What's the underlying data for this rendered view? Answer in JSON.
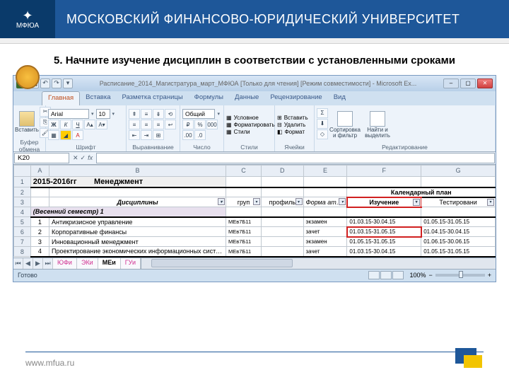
{
  "uni": {
    "logo": "МФЮА",
    "title": "МОСКОВСКИЙ ФИНАНСОВО-ЮРИДИЧЕСКИЙ УНИВЕРСИТЕТ"
  },
  "slide_title": "5. Начните изучение дисциплин в соответствии с установленными сроками",
  "window_title": "Расписание_2014_Магистратура_март_МФЮА [Только для чтения] [Режим совместимости] - Microsoft Ex...",
  "tabs": {
    "home": "Главная",
    "insert": "Вставка",
    "layout": "Разметка страницы",
    "formulas": "Формулы",
    "data": "Данные",
    "review": "Рецензирование",
    "view": "Вид"
  },
  "ribbon": {
    "clipboard": {
      "paste": "Вставить",
      "label": "Буфер обмена"
    },
    "font": {
      "name": "Arial",
      "size": "10",
      "label": "Шрифт",
      "bold": "Ж",
      "italic": "К",
      "underline": "Ч"
    },
    "align": {
      "label": "Выравнивание"
    },
    "number": {
      "format": "Общий",
      "label": "Число"
    },
    "styles": {
      "cond": "Условное",
      "fmt_tbl": "Форматировать",
      "cell_st": "Стили",
      "label": "Стили"
    },
    "cells": {
      "insert": "Вставить",
      "delete": "Удалить",
      "format": "Формат",
      "label": "Ячейки"
    },
    "editing": {
      "sum": "Σ",
      "sort": "Сортировка и фильтр",
      "find": "Найти и выделить",
      "label": "Редактирование"
    }
  },
  "name_box": "K20",
  "columns": {
    "sel": "",
    "A": "A",
    "B": "B",
    "C": "C",
    "D": "D",
    "E": "E",
    "F": "F",
    "G": "G"
  },
  "row1": {
    "years": "2015-2016гг",
    "title": "Менеджмент"
  },
  "hdr_right": "Календарный план",
  "headers": {
    "disc": "Дисциплины",
    "grp": "груп",
    "profile": "профиль",
    "form": "Форма аттестаци",
    "study": "Изучение",
    "test": "Тестировани"
  },
  "semester": "(Весенний семестр)   1",
  "rows": [
    {
      "n": "1",
      "name": "Антикризисное управление",
      "grp": "МЕв7Б11",
      "prof": "",
      "form": "экзамен",
      "study": "01.03.15-30.04.15",
      "test": "01.05.15-31.05.15"
    },
    {
      "n": "2",
      "name": "Корпоративные финансы",
      "grp": "МЕв7Б11",
      "prof": "",
      "form": "зачет",
      "study": "01.03.15-31.05.15",
      "test": "01.04.15-30.04.15"
    },
    {
      "n": "3",
      "name": "Инновационный менеджмент",
      "grp": "МЕв7Б11",
      "prof": "",
      "form": "экзамен",
      "study": "01.05.15-31.05.15",
      "test": "01.06.15-30.06.15"
    },
    {
      "n": "4",
      "name": "Проектирование экономических информационных систем",
      "grp": "МЕв7Б11",
      "prof": "",
      "form": "зачет",
      "study": "01.03.15-30.04.15",
      "test": "01.05.15-31.05.15"
    }
  ],
  "sheets": {
    "s1": "ЮФи",
    "s2": "ЭКи",
    "s3": "МЕи",
    "s4": "ГУи"
  },
  "status": {
    "ready": "Готово",
    "zoom": "100%"
  },
  "footer_url": "www.mfua.ru"
}
